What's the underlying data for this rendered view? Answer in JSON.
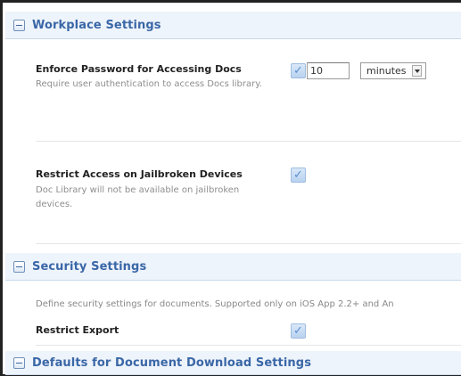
{
  "workplace": {
    "title": "Workplace Settings",
    "enforce_password": {
      "label": "Enforce Password for Accessing Docs",
      "description": "Require user authentication to access Docs library.",
      "checked": true,
      "value": "10",
      "unit": "minutes"
    },
    "restrict_jailbroken": {
      "label": "Restrict Access on Jailbroken Devices",
      "description": "Doc Library will not be available on jailbroken devices.",
      "checked": true
    }
  },
  "security": {
    "title": "Security Settings",
    "intro": "Define security settings for documents. Supported only on iOS App 2.2+ and An",
    "restrict_export": {
      "label": "Restrict Export",
      "checked": true
    }
  },
  "defaults": {
    "title": "Defaults for Document Download Settings"
  },
  "icons": {
    "collapse": "minus-box-icon",
    "check": "checkmark-icon"
  },
  "colors": {
    "section_title": "#3a67a7",
    "header_bg": "#eef4fb",
    "checkbox": "#c7dcf3"
  }
}
